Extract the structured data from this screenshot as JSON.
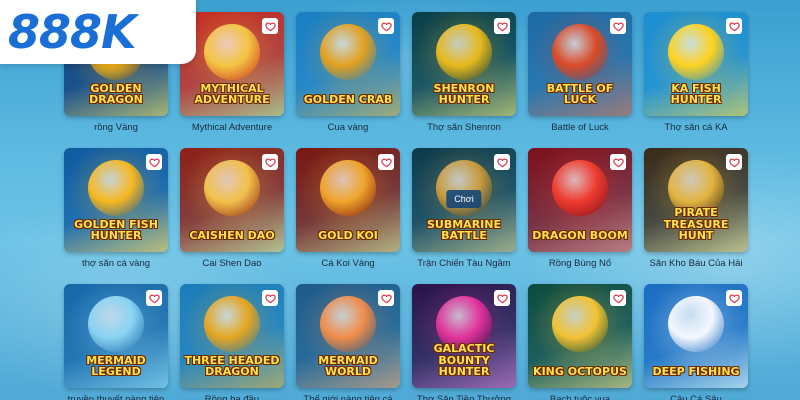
{
  "brand": {
    "logo": "888K"
  },
  "play_label": "Chơi",
  "games": [
    {
      "title": "Golden Dragon",
      "label": "rồng Vàng",
      "colors": [
        "#0e3b7a",
        "#f2b317"
      ]
    },
    {
      "title": "Mythical Adventure",
      "label": "Mythical Adventure",
      "colors": [
        "#c92a1e",
        "#f4c542"
      ]
    },
    {
      "title": "Golden Crab",
      "label": "Cua vàng",
      "colors": [
        "#1b7fc4",
        "#e2a01f"
      ]
    },
    {
      "title": "Shenron Hunter",
      "label": "Thợ săn Shenron",
      "colors": [
        "#0b3f46",
        "#e8b91c"
      ]
    },
    {
      "title": "Battle of Luck",
      "label": "Battle of Luck",
      "colors": [
        "#1e6aa6",
        "#d94a26"
      ]
    },
    {
      "title": "KA Fish Hunter",
      "label": "Thợ săn cá KA",
      "colors": [
        "#1d8ed1",
        "#ffd21f"
      ]
    },
    {
      "title": "Golden Fish Hunter",
      "label": "thợ săn cá vàng",
      "colors": [
        "#0f5aa1",
        "#f7b820"
      ]
    },
    {
      "title": "Caishen Dao",
      "label": "Cai Shen Dao",
      "colors": [
        "#8e1f14",
        "#f2c14a"
      ]
    },
    {
      "title": "Gold Koi",
      "label": "Cá Koi Vàng",
      "colors": [
        "#7a160f",
        "#f0a42b"
      ]
    },
    {
      "title": "Submarine Battle",
      "label": "Trận Chiến Tàu Ngầm",
      "colors": [
        "#0e3a4a",
        "#c99a3c"
      ]
    },
    {
      "title": "Dragon Boom",
      "label": "Rồng Bùng Nổ",
      "colors": [
        "#7d0f1b",
        "#ef3b2e"
      ]
    },
    {
      "title": "Pirate Treasure Hunt",
      "label": "Săn Kho Báu Của Hải",
      "colors": [
        "#3c2a18",
        "#e3b440"
      ]
    },
    {
      "title": "Mermaid Legend",
      "label": "truyền thuyết nàng tiên",
      "colors": [
        "#1566a8",
        "#8ad3f2"
      ]
    },
    {
      "title": "Three Headed Dragon",
      "label": "Rồng ba đầu",
      "colors": [
        "#1a7bb8",
        "#e5a520"
      ]
    },
    {
      "title": "Mermaid World",
      "label": "Thế giới nàng tiên cá",
      "colors": [
        "#1c5a8a",
        "#f08c4a"
      ]
    },
    {
      "title": "Galactic Bounty Hunter",
      "label": "Thợ Săn Tiền Thưởng",
      "colors": [
        "#2a1248",
        "#e0329a"
      ]
    },
    {
      "title": "King Octopus",
      "label": "Bạch tuộc vua",
      "colors": [
        "#0e4a3c",
        "#f2c233"
      ]
    },
    {
      "title": "Deep Fishing",
      "label": "Câu Cá Sâu",
      "colors": [
        "#1a6cc2",
        "#f3f7ff"
      ]
    }
  ]
}
